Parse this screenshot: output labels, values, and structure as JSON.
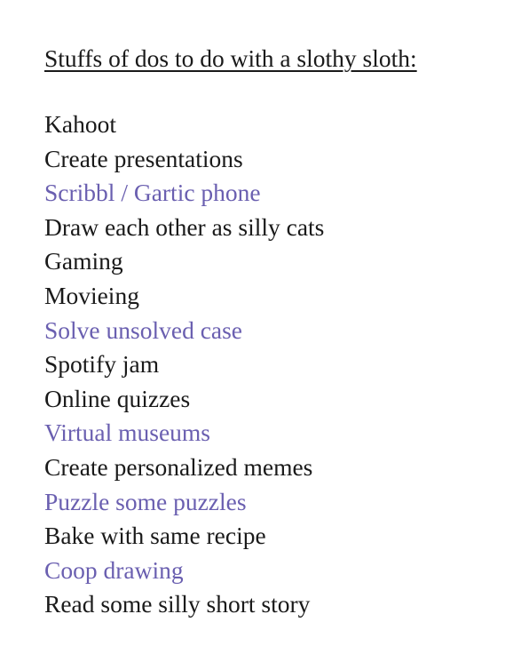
{
  "title": "Stuffs of dos to do with a slothy sloth:",
  "colors": {
    "text": "#1a1a1a",
    "highlight": "#6a5fb0",
    "background": "#ffffff"
  },
  "items": [
    {
      "text": "Kahoot",
      "highlighted": false
    },
    {
      "text": "Create presentations",
      "highlighted": false
    },
    {
      "text": "Scribbl / Gartic phone",
      "highlighted": true
    },
    {
      "text": "Draw each other as silly cats",
      "highlighted": false
    },
    {
      "text": "Gaming",
      "highlighted": false
    },
    {
      "text": "Movieing",
      "highlighted": false
    },
    {
      "text": "Solve unsolved case",
      "highlighted": true
    },
    {
      "text": "Spotify jam",
      "highlighted": false
    },
    {
      "text": "Online quizzes",
      "highlighted": false
    },
    {
      "text": "Virtual museums",
      "highlighted": true
    },
    {
      "text": "Create personalized memes",
      "highlighted": false
    },
    {
      "text": "Puzzle some puzzles",
      "highlighted": true
    },
    {
      "text": "Bake with same recipe",
      "highlighted": false
    },
    {
      "text": "Coop drawing",
      "highlighted": true
    },
    {
      "text": "Read some silly short story",
      "highlighted": false
    }
  ]
}
